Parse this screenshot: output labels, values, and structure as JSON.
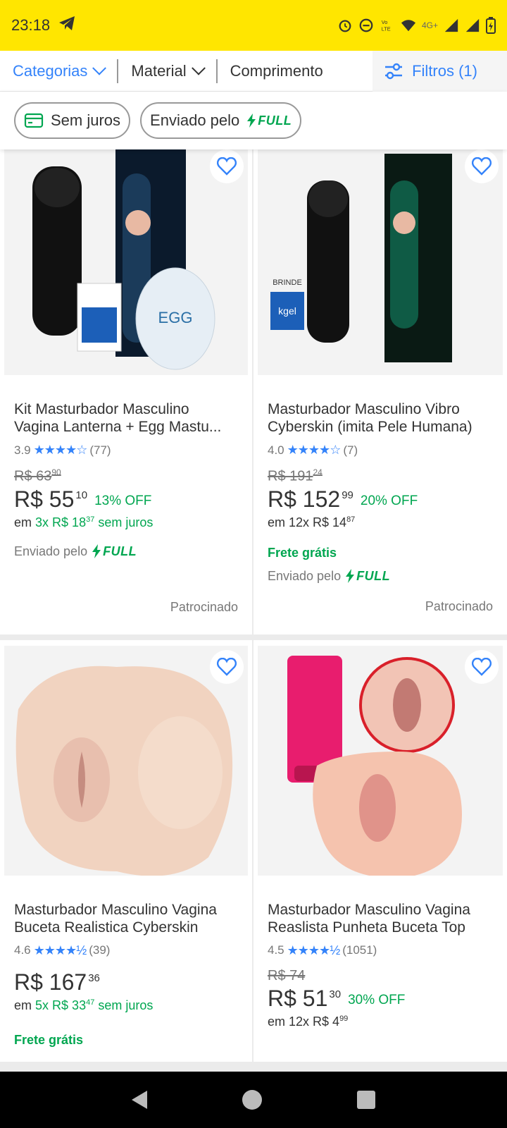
{
  "status_bar": {
    "time": "23:18",
    "network": "4G+"
  },
  "filter_bar": {
    "categorias": "Categorias",
    "material": "Material",
    "comprimento": "Comprimento",
    "filtros": "Filtros (1)"
  },
  "chips": {
    "sem_juros": "Sem juros",
    "enviado_pelo": "Enviado pelo",
    "full": "FULL"
  },
  "colors": {
    "accent": "#3483fa",
    "green": "#00a650",
    "brand_yellow": "#ffe600"
  },
  "products": [
    {
      "title": "Kit Masturbador Masculino Vagina Lanterna + Egg Mastu...",
      "rating": "3.9",
      "reviews": "(77)",
      "old_price": "R$ 63",
      "old_cents": "90",
      "price": "R$ 55",
      "price_cents": "10",
      "off": "13% OFF",
      "install_prefix": "em",
      "install_value": "3x R$ 18",
      "install_cents": "37",
      "install_suffix": "sem juros",
      "sent_by": "Enviado pelo",
      "full": "FULL",
      "sponsored": "Patrocinado"
    },
    {
      "title": "Masturbador Masculino Vibro Cyberskin (imita Pele Humana)",
      "rating": "4.0",
      "reviews": "(7)",
      "old_price": "R$ 191",
      "old_cents": "24",
      "price": "R$ 152",
      "price_cents": "99",
      "off": "20% OFF",
      "install_prefix": "em 12x R$ 14",
      "install_cents": "87",
      "freight": "Frete grátis",
      "sent_by": "Enviado pelo",
      "full": "FULL",
      "sponsored": "Patrocinado",
      "image_labels": {
        "brinde": "BRINDE",
        "kgel": "kgel"
      }
    },
    {
      "title": "Masturbador Masculino Vagina Buceta Realistica Cyberskin",
      "rating": "4.6",
      "reviews": "(39)",
      "price": "R$ 167",
      "price_cents": "36",
      "install_prefix": "em",
      "install_value": "5x R$ 33",
      "install_cents": "47",
      "install_suffix": "sem juros",
      "freight": "Frete grátis"
    },
    {
      "title": "Masturbador Masculino Vagina Reaslista Punheta Buceta Top",
      "rating": "4.5",
      "reviews": "(1051)",
      "old_price": "R$ 74",
      "price": "R$ 51",
      "price_cents": "30",
      "off": "30% OFF",
      "install_prefix": "em 12x R$ 4",
      "install_cents": "99"
    }
  ]
}
